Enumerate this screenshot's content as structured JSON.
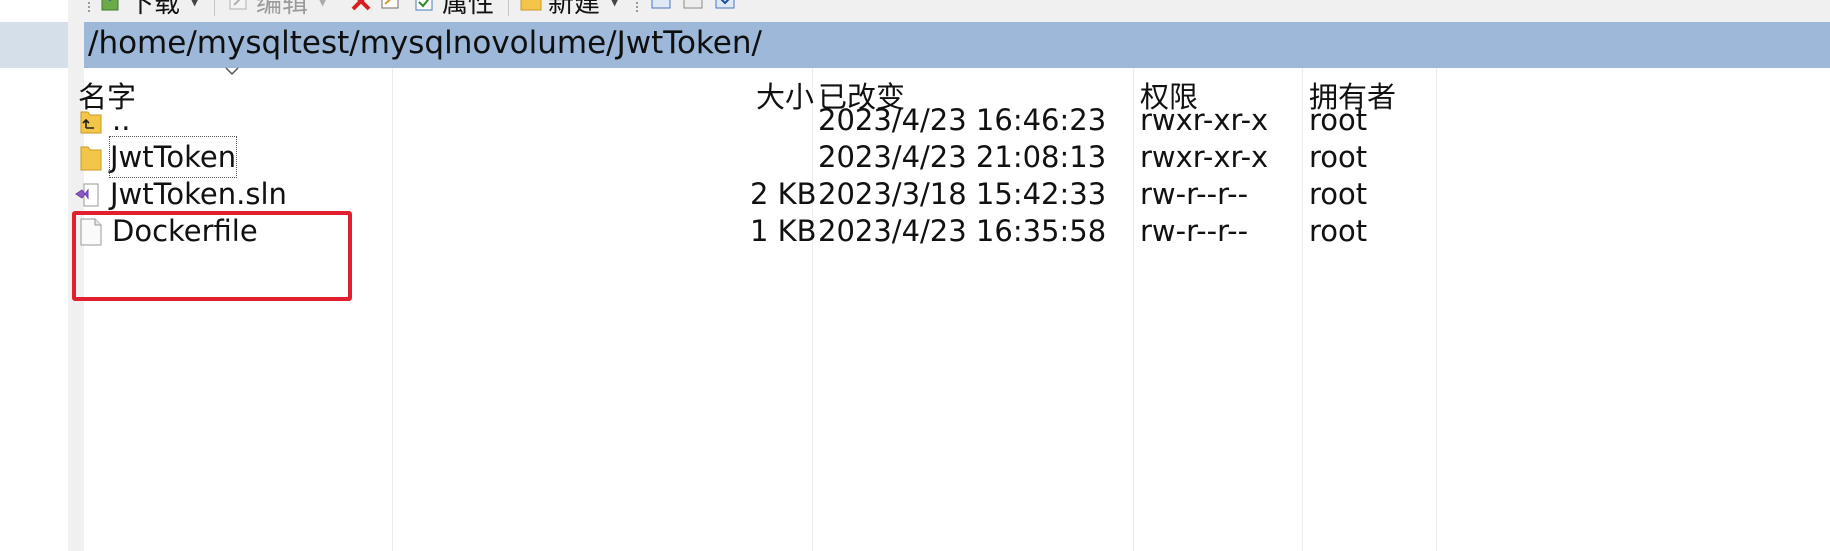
{
  "toolbar": {
    "download_label": "下载",
    "edit_label": "编辑",
    "properties_label": "属性",
    "new_label": "新建"
  },
  "path": "/home/mysqltest/mysqlnovolume/JwtToken/",
  "columns": {
    "name": "名字",
    "size": "大小",
    "modified": "已改变",
    "permissions": "权限",
    "owner": "拥有者"
  },
  "files": [
    {
      "name": "..",
      "size": "",
      "modified": "2023/4/23 16:46:23",
      "permissions": "rwxr-xr-x",
      "owner": "root",
      "icon": "parent-folder-icon"
    },
    {
      "name": "JwtToken",
      "size": "",
      "modified": "2023/4/23 21:08:13",
      "permissions": "rwxr-xr-x",
      "owner": "root",
      "icon": "folder-icon"
    },
    {
      "name": "JwtToken.sln",
      "size": "2 KB",
      "modified": "2023/3/18 15:42:33",
      "permissions": "rw-r--r--",
      "owner": "root",
      "icon": "visual-studio-solution-icon"
    },
    {
      "name": "Dockerfile",
      "size": "1 KB",
      "modified": "2023/4/23 16:35:58",
      "permissions": "rw-r--r--",
      "owner": "root",
      "icon": "file-icon"
    }
  ],
  "colors": {
    "pathbar": "#9db8d8",
    "highlight": "#e0202e",
    "folder": "#f3c548"
  }
}
